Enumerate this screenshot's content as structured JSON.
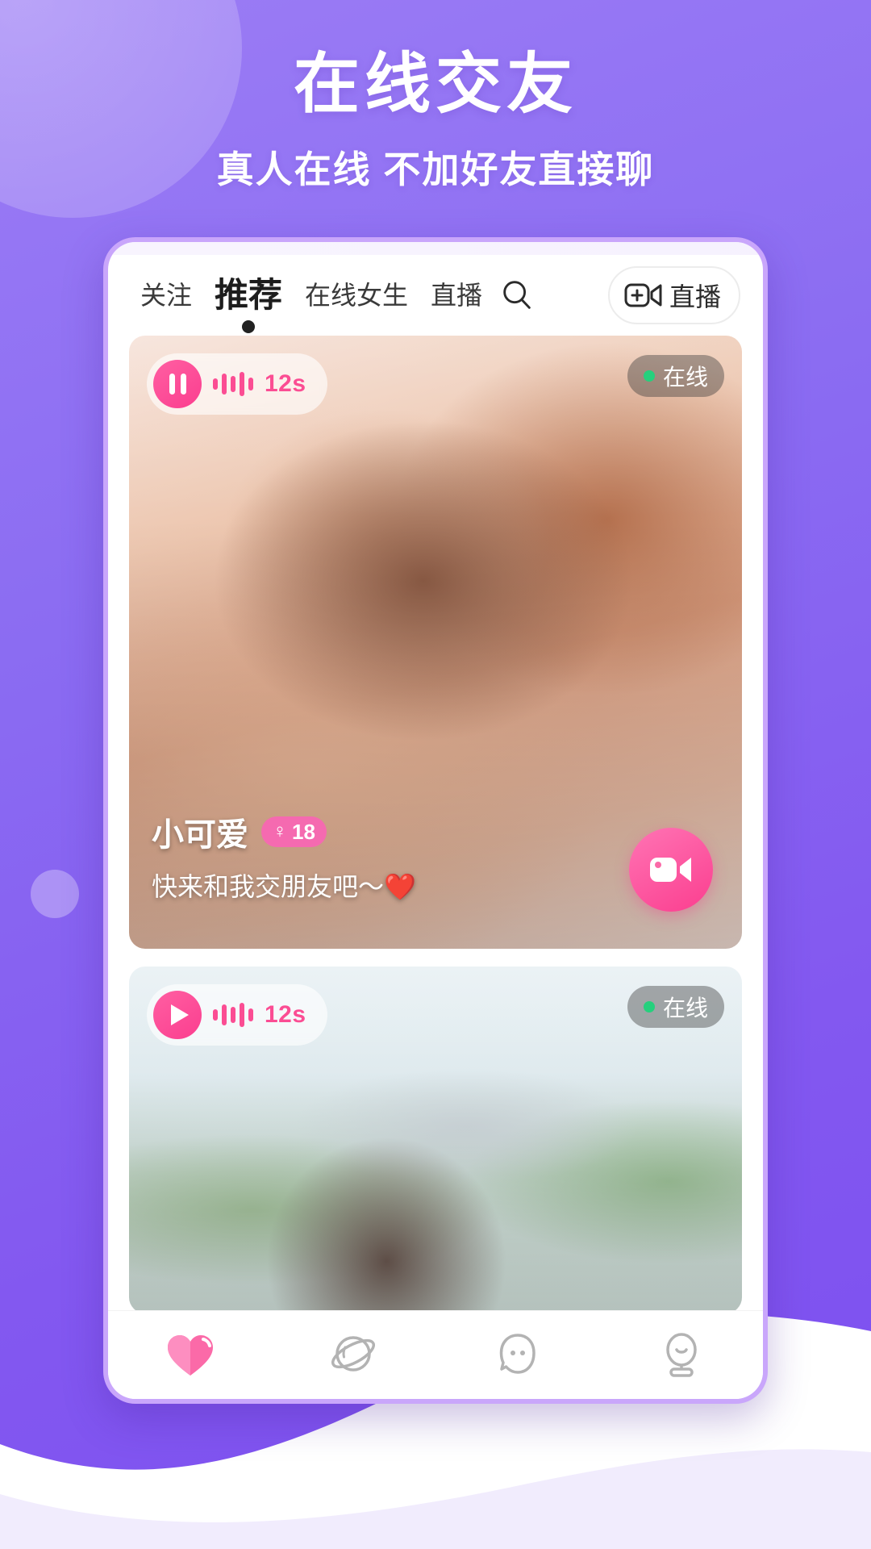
{
  "promo": {
    "title": "在线交友",
    "subtitle": "真人在线 不加好友直接聊"
  },
  "theme": {
    "bg_purple": "#8358f0",
    "frame_purple": "#c9a6fb",
    "accent_pink": "#fb3e8f",
    "badge_pink": "#f56ab0",
    "online_green": "#25d07d"
  },
  "topnav": {
    "tabs": [
      {
        "label": "关注",
        "active": false
      },
      {
        "label": "推荐",
        "active": true
      },
      {
        "label": "在线女生",
        "active": false
      },
      {
        "label": "直播",
        "active": false
      }
    ],
    "search_icon": "search-icon",
    "live_button": {
      "icon": "video-plus-icon",
      "label": "直播"
    }
  },
  "feed": {
    "cards": [
      {
        "audio": {
          "state": "pause",
          "duration": "12s",
          "waveform": [
            14,
            26,
            20,
            30,
            16
          ]
        },
        "status": {
          "label": "在线",
          "dot": "online-dot"
        },
        "profile": {
          "name": "小可爱",
          "gender_symbol": "♀",
          "age": "18",
          "bio": "快来和我交朋友吧～❤️"
        },
        "action": {
          "icon": "video-call-icon"
        }
      },
      {
        "audio": {
          "state": "play",
          "duration": "12s",
          "waveform": [
            14,
            26,
            20,
            30,
            16
          ]
        },
        "status": {
          "label": "在线",
          "dot": "online-dot"
        }
      }
    ]
  },
  "bottomnav": {
    "items": [
      {
        "icon": "heart-icon",
        "active": true
      },
      {
        "icon": "planet-icon",
        "active": false
      },
      {
        "icon": "chat-face-icon",
        "active": false
      },
      {
        "icon": "person-icon",
        "active": false
      }
    ]
  }
}
